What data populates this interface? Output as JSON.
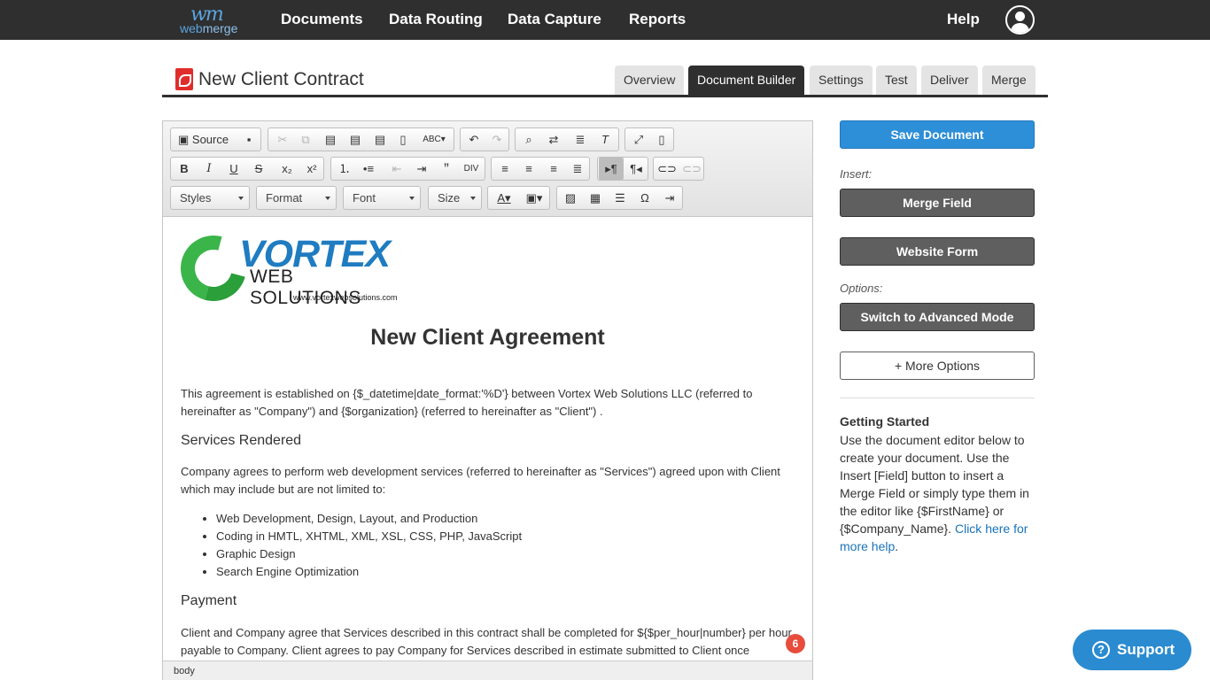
{
  "nav": {
    "logo_mark": "wm",
    "logo_web": "web",
    "logo_merge": "merge",
    "links": [
      "Documents",
      "Data Routing",
      "Data Capture",
      "Reports"
    ],
    "help": "Help"
  },
  "header": {
    "title": "New Client Contract",
    "tabs": [
      "Overview",
      "Document Builder",
      "Settings",
      "Test",
      "Deliver",
      "Merge"
    ],
    "active_tab": "Document Builder"
  },
  "toolbar": {
    "source_label": "Source",
    "styles_label": "Styles",
    "format_label": "Format",
    "font_label": "Font",
    "size_label": "Size"
  },
  "document": {
    "logo_name": "VORTEX",
    "logo_sub": "WEB SOLUTIONS",
    "logo_url": "www.vortexwebsolutions.com",
    "title": "New Client Agreement",
    "intro": "This agreement is established on {$_datetime|date_format:'%D'} between Vortex Web Solutions LLC (referred to hereinafter as \"Company\") and {$organization} (referred to hereinafter as \"Client\") .",
    "h_services": "Services Rendered",
    "services_text": "Company agrees to perform web development services (referred to hereinafter as \"Services\") agreed upon with Client which may include but are not limited to:",
    "services_list": [
      "Web Development, Design, Layout, and Production",
      "Coding in HMTL, XHTML, XML, XSL, CSS, PHP, JavaScript",
      "Graphic Design",
      "Search Engine Optimization"
    ],
    "h_payment": "Payment",
    "payment_text": "Client and Company agree that Services described in this contract shall be completed for ${$per_hour|number} per hour payable to Company. Client agrees to pay Company for Services described in estimate submitted to Client once",
    "badge_count": "6",
    "status_path": "body"
  },
  "sidebar": {
    "save_button": "Save Document",
    "insert_label": "Insert:",
    "merge_field_button": "Merge Field",
    "website_form_button": "Website Form",
    "options_label": "Options:",
    "advanced_button": "Switch to Advanced Mode",
    "more_options_button": "+ More Options",
    "getting_started_title": "Getting Started",
    "getting_started_text": "Use the document editor below to create your document. Use the Insert [Field] button to insert a Merge Field or simply type them in the editor like {$FirstName} or {$Company_Name}.",
    "help_link": "Click here for more help",
    "help_suffix": "."
  },
  "support": {
    "label": "Support"
  },
  "colors": {
    "topbar": "#2f2f2f",
    "primary": "#2d8fd8",
    "dark_button": "#5f5f5f",
    "link": "#1a73b8",
    "badge": "#e74c3c"
  }
}
